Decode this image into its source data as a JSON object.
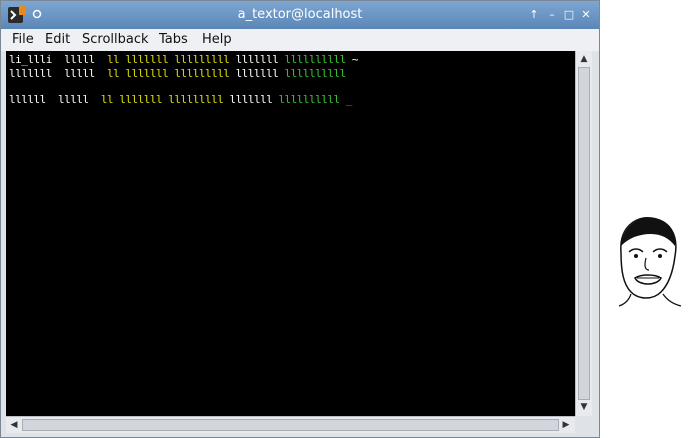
{
  "window": {
    "title": "a_textor@localhost",
    "buttons": [
      "↑",
      "–",
      "□",
      "✕"
    ]
  },
  "menu": [
    "File",
    "Edit",
    "Scrollback",
    "Tabs",
    "Help"
  ],
  "terminal": {
    "rows": [
      [
        {
          "text": "li_llli",
          "color": "#ffffff"
        },
        {
          "text": "  ",
          "color": "#2b3bd6"
        },
        {
          "text": "lllll ",
          "color": "#ffffff"
        },
        {
          "text": " ll lllllll lllllllll ",
          "color": "#e0e000"
        },
        {
          "text": "lllllll",
          "color": "#ffffff"
        },
        {
          "text": " ",
          "color": "#2b3bd6"
        },
        {
          "text": "llllllllll",
          "color": "#37c837"
        },
        {
          "text": " ~",
          "color": "#ffffff"
        }
      ],
      [
        {
          "text": "lllllll",
          "color": "#ffffff"
        },
        {
          "text": "  ",
          "color": "#2b3bd6"
        },
        {
          "text": "lllll ",
          "color": "#ffffff"
        },
        {
          "text": " ll lllllll lllllllll ",
          "color": "#e0e000"
        },
        {
          "text": "lllllll",
          "color": "#ffffff"
        },
        {
          "text": " ",
          "color": "#2b3bd6"
        },
        {
          "text": "llllllllll",
          "color": "#37c837"
        }
      ],
      [
        {
          "text": "llllll",
          "color": "#ffffff"
        },
        {
          "text": "  ",
          "color": "#2b3bd6"
        },
        {
          "text": "lllll ",
          "color": "#ffffff"
        },
        {
          "text": " ll lllllll lllllllll ",
          "color": "#e0e000"
        },
        {
          "text": "lllllll",
          "color": "#ffffff"
        },
        {
          "text": " ",
          "color": "#2b3bd6"
        },
        {
          "text": "llllllllll",
          "color": "#37c837"
        },
        {
          "text": " _",
          "color": "#37c837"
        }
      ]
    ]
  },
  "colors": {
    "titlebar": "#6a95c4",
    "terminal_bg": "#000000",
    "fg_white": "#ffffff",
    "fg_yellow": "#e0e000",
    "fg_green": "#37c837",
    "fg_blue": "#2b3bd6"
  },
  "icons": {
    "app": "terminal-app-icon",
    "pin": "pin-icon",
    "side_image": "meme-face-icon"
  }
}
